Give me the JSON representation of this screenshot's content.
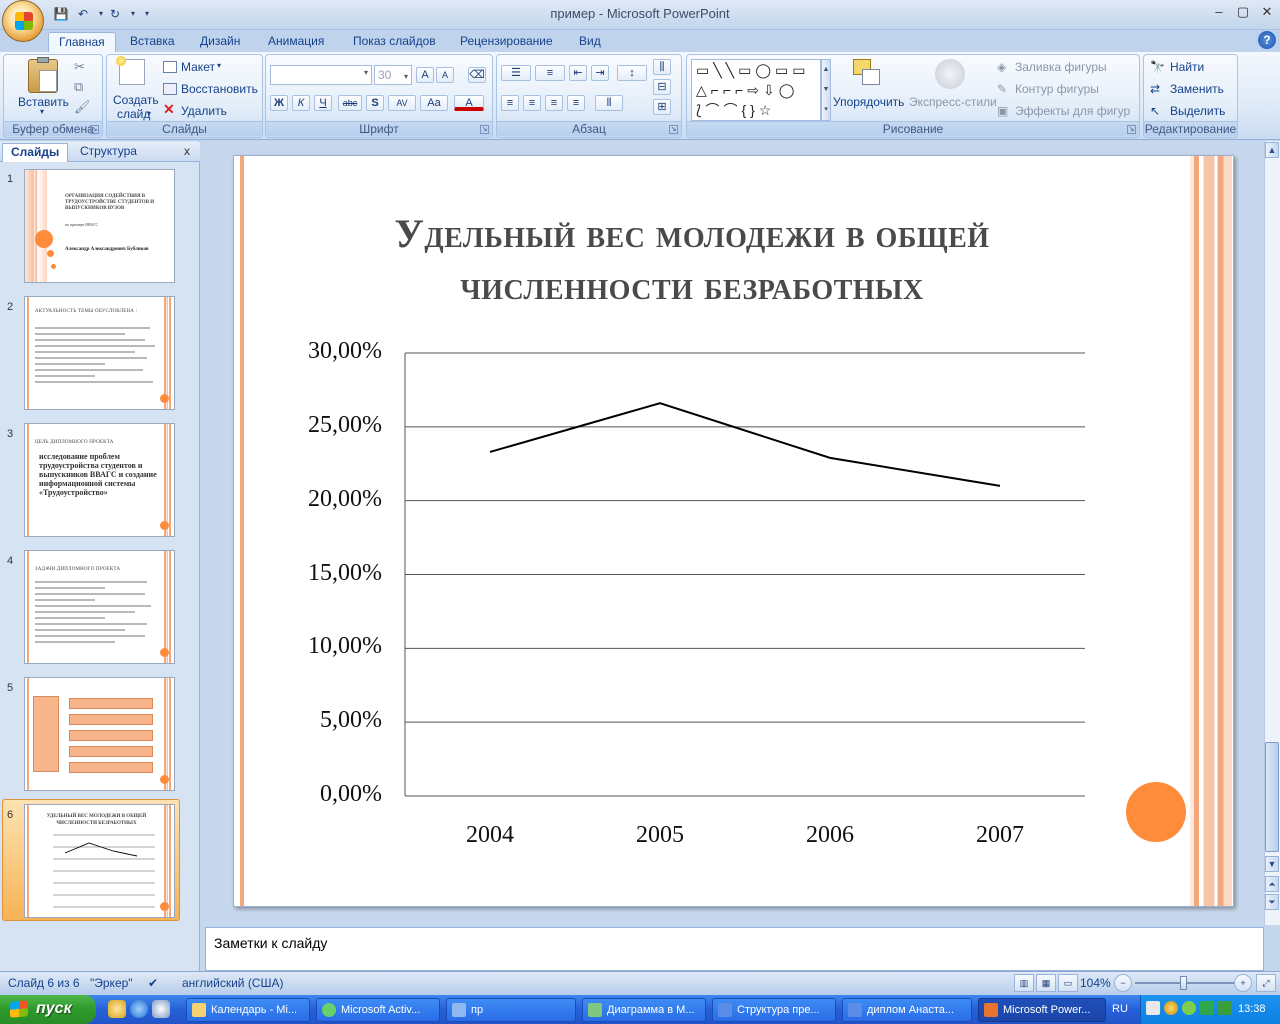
{
  "window": {
    "title": "пример - Microsoft PowerPoint",
    "minimize": "‒",
    "maximize": "▢",
    "close": "✕"
  },
  "tabs": [
    "Главная",
    "Вставка",
    "Дизайн",
    "Анимация",
    "Показ слайдов",
    "Рецензирование",
    "Вид"
  ],
  "ribbon": {
    "clipboard": {
      "label": "Буфер обмена",
      "paste": "Вставить"
    },
    "slides": {
      "label": "Слайды",
      "new_slide": "Создать",
      "new_slide2": "слайд",
      "layout": "Макет",
      "reset": "Восстановить",
      "delete": "Удалить"
    },
    "font": {
      "label": "Шрифт",
      "font_name": "",
      "font_size": "30",
      "bold": "Ж",
      "italic": "К",
      "underline": "Ч",
      "strike": "abc",
      "shadow": "S",
      "spacing": "AV",
      "case": "Aa",
      "color": "A"
    },
    "paragraph": {
      "label": "Абзац"
    },
    "drawing": {
      "label": "Рисование",
      "arrange": "Упорядочить",
      "quick_styles": "Экспресс-стили",
      "fill": "Заливка фигуры",
      "outline": "Контур фигуры",
      "effects": "Эффекты для фигур"
    },
    "editing": {
      "label": "Редактирование",
      "find": "Найти",
      "replace": "Заменить",
      "select": "Выделить"
    }
  },
  "pane": {
    "tab_slides": "Слайды",
    "tab_outline": "Структура",
    "close": "x",
    "slides": [
      {
        "num": "1",
        "title": "ОРГАНИЗАЦИЯ СОДЕЙСТВИЯ В ТРУДОУСТРОЙСТВЕ СТУДЕНТОВ И ВЫПУСКНИКОВ ВУЗОВ",
        "sub": "на примере ВВАГС",
        "author": "Александр Александрович Бубликов"
      },
      {
        "num": "2",
        "title": "АКТУАЛЬНОСТЬ ТЕМЫ ОБУСЛОВЛЕНА :"
      },
      {
        "num": "3",
        "title": "ЦЕЛЬ ДИПЛОМНОГО ПРОЕКТА",
        "body": "исследование проблем трудоустройства студентов и выпускников ВВАГС и создание информационной системы «Трудоустройство»"
      },
      {
        "num": "4",
        "title": "ЗАДАЧИ ДИПЛОМНОГО ПРОЕКТА"
      },
      {
        "num": "5",
        "title": ""
      },
      {
        "num": "6",
        "title": "УДЕЛЬНЫЙ ВЕС МОЛОДЕЖИ В ОБЩЕЙ ЧИСЛЕННОСТИ БЕЗРАБОТНЫХ"
      }
    ]
  },
  "slide": {
    "title": "Удельный вес молодежи в общей численности безработных"
  },
  "chart_data": {
    "type": "line",
    "title": "Удельный вес молодежи в общей численности безработных",
    "categories": [
      "2004",
      "2005",
      "2006",
      "2007"
    ],
    "series": [
      {
        "values": [
          0.233,
          0.266,
          0.229,
          0.21
        ]
      }
    ],
    "ylim": [
      0,
      0.3
    ],
    "yticks": [
      "0,00%",
      "5,00%",
      "10,00%",
      "15,00%",
      "20,00%",
      "25,00%",
      "30,00%"
    ],
    "grid": true,
    "legend": "none",
    "line_color": "#000000"
  },
  "notes": {
    "placeholder": "Заметки к слайду"
  },
  "status": {
    "slide_count": "Слайд 6 из 6",
    "theme": "\"Эркер\"",
    "language": "английский (США)",
    "zoom": "104%"
  },
  "taskbar": {
    "start": "пуск",
    "tasks": [
      "Календарь - Mi...",
      "Microsoft Activ...",
      "пр",
      "Диаграмма в M...",
      "Структура пре...",
      "диплом Анаста...",
      "Microsoft Power..."
    ],
    "lang": "RU",
    "clock": "13:38"
  },
  "colors": {
    "accent": "#ff8c3a",
    "ribbon_text": "#15428b",
    "taskbar": "#2660d8"
  }
}
